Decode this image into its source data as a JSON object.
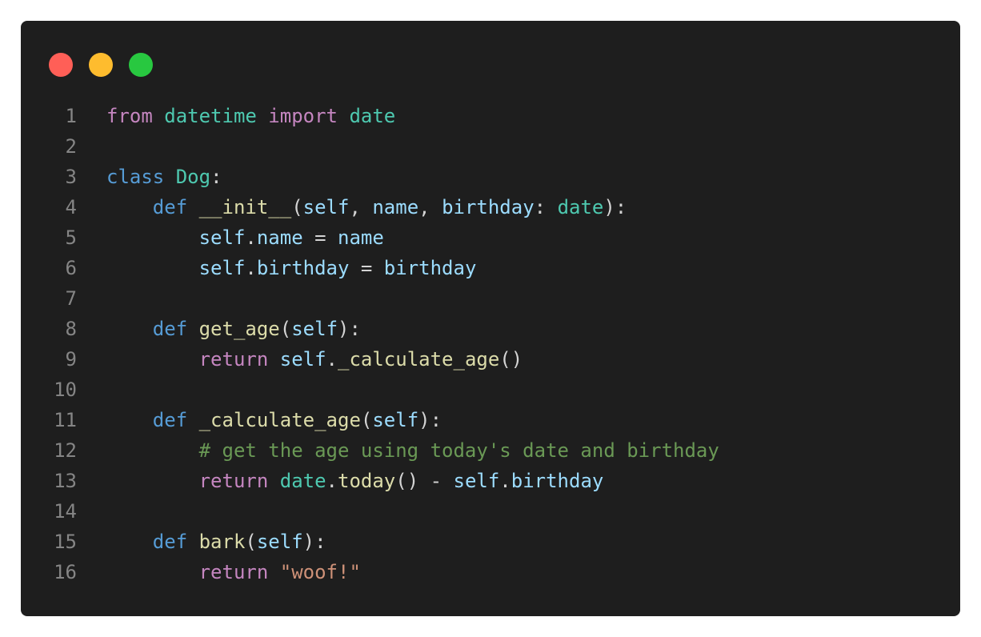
{
  "window": {
    "controls": [
      {
        "name": "close",
        "color": "#ff5f57"
      },
      {
        "name": "minimize",
        "color": "#febc2e"
      },
      {
        "name": "maximize",
        "color": "#28c840"
      }
    ]
  },
  "editor": {
    "language": "python",
    "theme_colors": {
      "background": "#1e1e1e",
      "line_number": "#858585",
      "keyword": "#c586c0",
      "storage": "#569cd6",
      "type": "#4ec9b0",
      "function": "#dcdcaa",
      "variable": "#9cdcfe",
      "punctuation": "#d4d4d4",
      "string": "#ce9178",
      "comment": "#6a9955"
    },
    "lines": [
      {
        "number": "1",
        "tokens": [
          {
            "t": "from",
            "k": "keyword"
          },
          {
            "t": " ",
            "k": "punct"
          },
          {
            "t": "datetime",
            "k": "type"
          },
          {
            "t": " ",
            "k": "punct"
          },
          {
            "t": "import",
            "k": "keyword"
          },
          {
            "t": " ",
            "k": "punct"
          },
          {
            "t": "date",
            "k": "type"
          }
        ]
      },
      {
        "number": "2",
        "tokens": []
      },
      {
        "number": "3",
        "tokens": [
          {
            "t": "class",
            "k": "storage"
          },
          {
            "t": " ",
            "k": "punct"
          },
          {
            "t": "Dog",
            "k": "type"
          },
          {
            "t": ":",
            "k": "punct"
          }
        ]
      },
      {
        "number": "4",
        "tokens": [
          {
            "t": "    ",
            "k": "punct"
          },
          {
            "t": "def",
            "k": "storage"
          },
          {
            "t": " ",
            "k": "punct"
          },
          {
            "t": "__init__",
            "k": "func"
          },
          {
            "t": "(",
            "k": "punct"
          },
          {
            "t": "self",
            "k": "var"
          },
          {
            "t": ", ",
            "k": "punct"
          },
          {
            "t": "name",
            "k": "var"
          },
          {
            "t": ", ",
            "k": "punct"
          },
          {
            "t": "birthday",
            "k": "var"
          },
          {
            "t": ": ",
            "k": "punct"
          },
          {
            "t": "date",
            "k": "type"
          },
          {
            "t": "):",
            "k": "punct"
          }
        ]
      },
      {
        "number": "5",
        "tokens": [
          {
            "t": "        ",
            "k": "punct"
          },
          {
            "t": "self",
            "k": "var"
          },
          {
            "t": ".",
            "k": "punct"
          },
          {
            "t": "name",
            "k": "var"
          },
          {
            "t": " = ",
            "k": "punct"
          },
          {
            "t": "name",
            "k": "var"
          }
        ]
      },
      {
        "number": "6",
        "tokens": [
          {
            "t": "        ",
            "k": "punct"
          },
          {
            "t": "self",
            "k": "var"
          },
          {
            "t": ".",
            "k": "punct"
          },
          {
            "t": "birthday",
            "k": "var"
          },
          {
            "t": " = ",
            "k": "punct"
          },
          {
            "t": "birthday",
            "k": "var"
          }
        ]
      },
      {
        "number": "7",
        "tokens": []
      },
      {
        "number": "8",
        "tokens": [
          {
            "t": "    ",
            "k": "punct"
          },
          {
            "t": "def",
            "k": "storage"
          },
          {
            "t": " ",
            "k": "punct"
          },
          {
            "t": "get_age",
            "k": "func"
          },
          {
            "t": "(",
            "k": "punct"
          },
          {
            "t": "self",
            "k": "var"
          },
          {
            "t": "):",
            "k": "punct"
          }
        ]
      },
      {
        "number": "9",
        "tokens": [
          {
            "t": "        ",
            "k": "punct"
          },
          {
            "t": "return",
            "k": "keyword"
          },
          {
            "t": " ",
            "k": "punct"
          },
          {
            "t": "self",
            "k": "var"
          },
          {
            "t": ".",
            "k": "punct"
          },
          {
            "t": "_calculate_age",
            "k": "func"
          },
          {
            "t": "()",
            "k": "punct"
          }
        ]
      },
      {
        "number": "10",
        "tokens": []
      },
      {
        "number": "11",
        "tokens": [
          {
            "t": "    ",
            "k": "punct"
          },
          {
            "t": "def",
            "k": "storage"
          },
          {
            "t": " ",
            "k": "punct"
          },
          {
            "t": "_calculate_age",
            "k": "func"
          },
          {
            "t": "(",
            "k": "punct"
          },
          {
            "t": "self",
            "k": "var"
          },
          {
            "t": "):",
            "k": "punct"
          }
        ]
      },
      {
        "number": "12",
        "tokens": [
          {
            "t": "        ",
            "k": "punct"
          },
          {
            "t": "# get the age using today's date and birthday",
            "k": "comment"
          }
        ]
      },
      {
        "number": "13",
        "tokens": [
          {
            "t": "        ",
            "k": "punct"
          },
          {
            "t": "return",
            "k": "keyword"
          },
          {
            "t": " ",
            "k": "punct"
          },
          {
            "t": "date",
            "k": "type"
          },
          {
            "t": ".",
            "k": "punct"
          },
          {
            "t": "today",
            "k": "func"
          },
          {
            "t": "() - ",
            "k": "punct"
          },
          {
            "t": "self",
            "k": "var"
          },
          {
            "t": ".",
            "k": "punct"
          },
          {
            "t": "birthday",
            "k": "var"
          }
        ]
      },
      {
        "number": "14",
        "tokens": []
      },
      {
        "number": "15",
        "tokens": [
          {
            "t": "    ",
            "k": "punct"
          },
          {
            "t": "def",
            "k": "storage"
          },
          {
            "t": " ",
            "k": "punct"
          },
          {
            "t": "bark",
            "k": "func"
          },
          {
            "t": "(",
            "k": "punct"
          },
          {
            "t": "self",
            "k": "var"
          },
          {
            "t": "):",
            "k": "punct"
          }
        ]
      },
      {
        "number": "16",
        "tokens": [
          {
            "t": "        ",
            "k": "punct"
          },
          {
            "t": "return",
            "k": "keyword"
          },
          {
            "t": " ",
            "k": "punct"
          },
          {
            "t": "\"woof!\"",
            "k": "string"
          }
        ]
      }
    ]
  }
}
